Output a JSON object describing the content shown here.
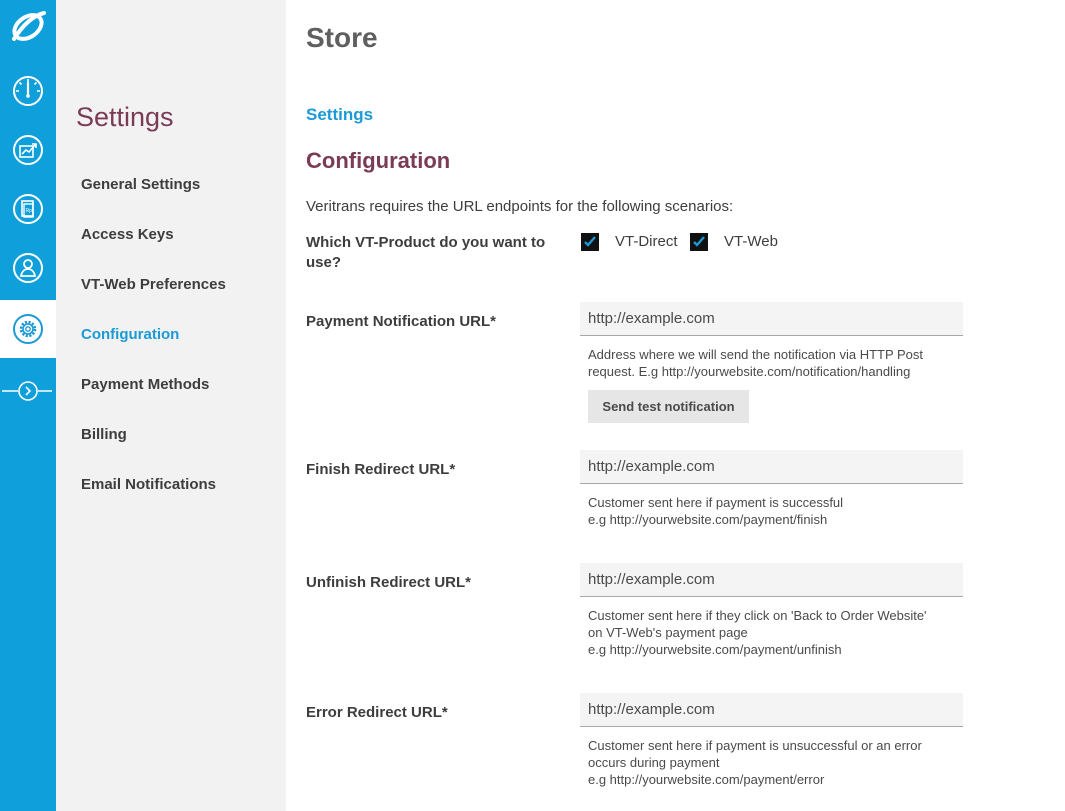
{
  "rail": {
    "items": [
      {
        "icon": "dashboard-gauge-icon"
      },
      {
        "icon": "transactions-chart-icon"
      },
      {
        "icon": "reports-document-icon"
      },
      {
        "icon": "user-profile-icon"
      },
      {
        "icon": "settings-gear-icon",
        "active": true
      },
      {
        "icon": "expand-arrow-icon"
      }
    ]
  },
  "sidebar": {
    "title": "Settings",
    "items": [
      {
        "label": "General Settings"
      },
      {
        "label": "Access Keys"
      },
      {
        "label": "VT-Web Preferences"
      },
      {
        "label": "Configuration",
        "active": true
      },
      {
        "label": "Payment Methods"
      },
      {
        "label": "Billing"
      },
      {
        "label": "Email Notifications"
      }
    ]
  },
  "header": {
    "title": "Store"
  },
  "breadcrumb": {
    "label": "Settings"
  },
  "section": {
    "title": "Configuration",
    "intro": "Veritrans requires the URL endpoints for the following scenarios:"
  },
  "product": {
    "label_line1": "Which VT-Product do you want to",
    "label_line2": "use?",
    "options": [
      {
        "label": "VT-Direct",
        "checked": true
      },
      {
        "label": "VT-Web",
        "checked": true
      }
    ]
  },
  "fields": [
    {
      "label": "Payment Notification URL*",
      "value": "http://example.com",
      "help": [
        "Address where we will send the notification via HTTP Post",
        "request. E.g http://yourwebsite.com/notification/handling"
      ],
      "button": "Send test notification"
    },
    {
      "label": "Finish Redirect URL*",
      "value": "http://example.com",
      "help": [
        "Customer sent here if payment is successful",
        "e.g http://yourwebsite.com/payment/finish"
      ]
    },
    {
      "label": "Unfinish Redirect URL*",
      "value": "http://example.com",
      "help": [
        "Customer sent here if they click on 'Back to Order Website'",
        "on VT-Web's payment page",
        "e.g http://yourwebsite.com/payment/unfinish"
      ]
    },
    {
      "label": "Error Redirect URL*",
      "value": "http://example.com",
      "help": [
        "Customer sent here if payment is unsuccessful or an error",
        "occurs during payment",
        "e.g http://yourwebsite.com/payment/error"
      ]
    }
  ],
  "colors": {
    "rail": "#0f9fdb",
    "accent_blue": "#1b9ad6",
    "accent_plum": "#7b3a56",
    "sidebar_bg": "#f2f2f2"
  }
}
